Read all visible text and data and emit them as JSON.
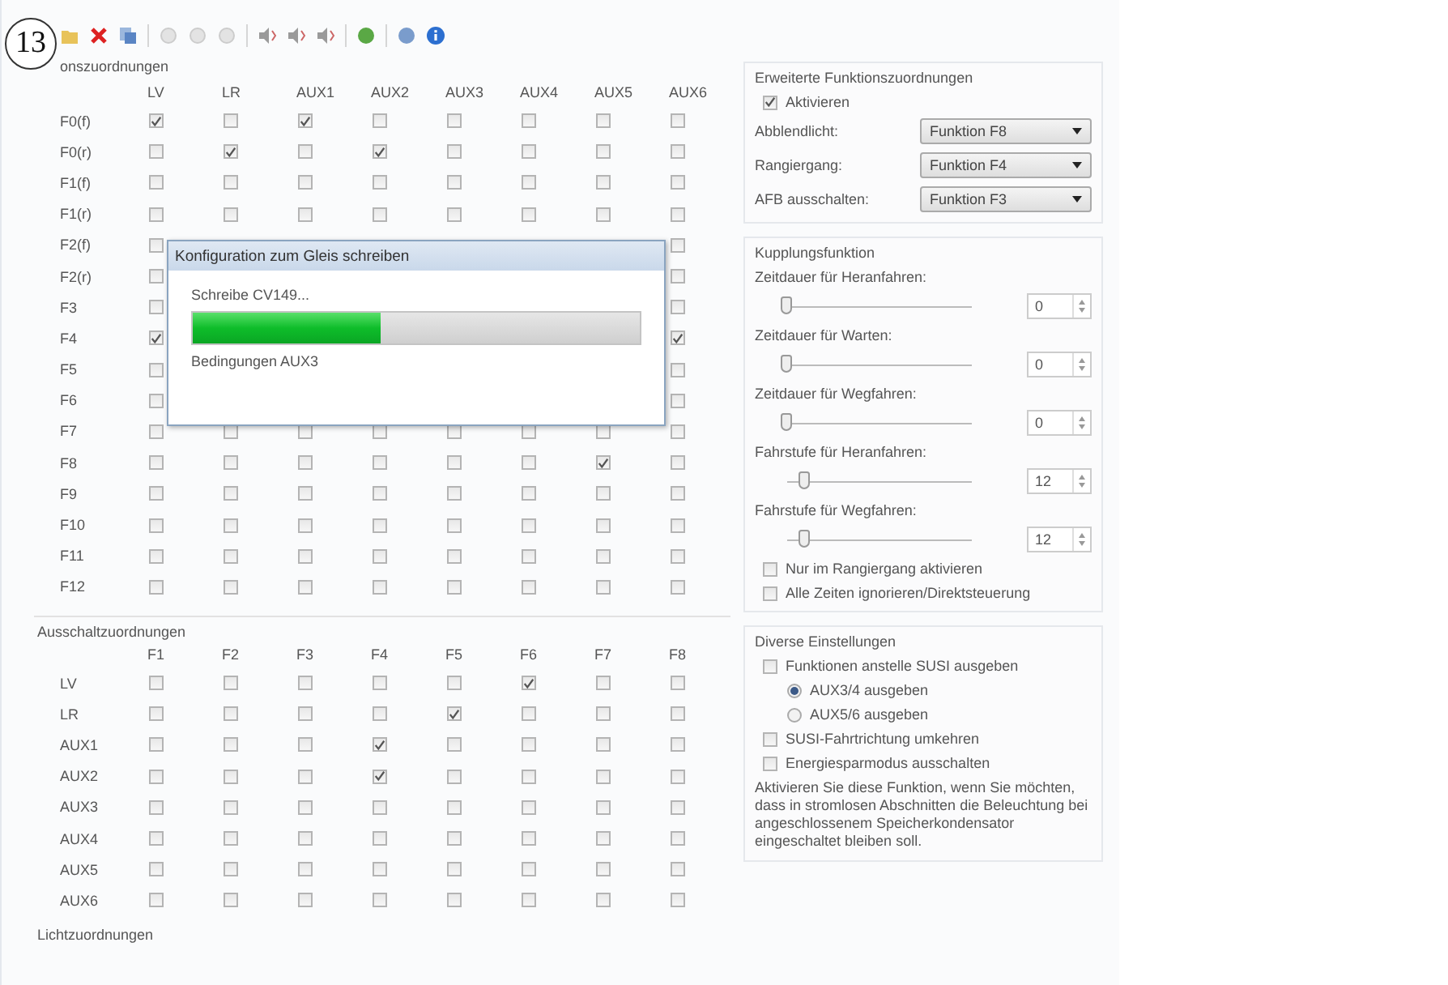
{
  "annotation": "13",
  "toolbar": [
    {
      "kind": "folder"
    },
    {
      "kind": "delete"
    },
    {
      "kind": "copy"
    },
    {
      "kind": "sep"
    },
    {
      "kind": "dot"
    },
    {
      "kind": "dot"
    },
    {
      "kind": "dot"
    },
    {
      "kind": "sep"
    },
    {
      "kind": "speaker"
    },
    {
      "kind": "speaker"
    },
    {
      "kind": "speaker"
    },
    {
      "kind": "sep"
    },
    {
      "kind": "globe"
    },
    {
      "kind": "sep"
    },
    {
      "kind": "help"
    },
    {
      "kind": "info"
    }
  ],
  "function_mapping": {
    "title": "onszuordnungen",
    "columns": [
      "LV",
      "LR",
      "AUX1",
      "AUX2",
      "AUX3",
      "AUX4",
      "AUX5",
      "AUX6"
    ],
    "rows": [
      {
        "label": "F0(f)",
        "cells": [
          {
            "checked": true
          },
          {
            "checked": false
          },
          {
            "checked": true
          },
          {
            "checked": false
          },
          {
            "checked": false
          },
          {
            "checked": false
          },
          {
            "checked": false
          },
          {
            "checked": false
          }
        ]
      },
      {
        "label": "F0(r)",
        "cells": [
          {
            "checked": false
          },
          {
            "checked": true
          },
          {
            "checked": false
          },
          {
            "checked": true
          },
          {
            "checked": false
          },
          {
            "checked": false
          },
          {
            "checked": false
          },
          {
            "checked": false
          }
        ]
      },
      {
        "label": "F1(f)",
        "cells": [
          {
            "checked": false
          },
          {
            "checked": false
          },
          {
            "checked": false
          },
          {
            "checked": false
          },
          {
            "checked": false
          },
          {
            "checked": false
          },
          {
            "checked": false
          },
          {
            "checked": false
          }
        ]
      },
      {
        "label": "F1(r)",
        "cells": [
          {
            "checked": false
          },
          {
            "checked": false
          },
          {
            "checked": false
          },
          {
            "checked": false
          },
          {
            "checked": false
          },
          {
            "checked": false
          },
          {
            "checked": false
          },
          {
            "checked": false
          }
        ]
      },
      {
        "label": "F2(f)",
        "cells": [
          {
            "checked": false
          },
          null,
          null,
          null,
          null,
          null,
          null,
          {
            "checked": false
          }
        ]
      },
      {
        "label": "F2(r)",
        "cells": [
          {
            "checked": false
          },
          null,
          null,
          null,
          null,
          null,
          null,
          {
            "checked": false
          }
        ]
      },
      {
        "label": "F3",
        "cells": [
          {
            "checked": false
          },
          null,
          null,
          null,
          null,
          null,
          null,
          {
            "checked": false
          }
        ]
      },
      {
        "label": "F4",
        "cells": [
          {
            "checked": true
          },
          null,
          null,
          null,
          null,
          null,
          null,
          {
            "checked": true
          }
        ]
      },
      {
        "label": "F5",
        "cells": [
          {
            "checked": false
          },
          null,
          null,
          null,
          null,
          null,
          null,
          {
            "checked": false
          }
        ]
      },
      {
        "label": "F6",
        "cells": [
          {
            "checked": false
          },
          null,
          null,
          null,
          null,
          null,
          null,
          {
            "checked": false
          }
        ]
      },
      {
        "label": "F7",
        "cells": [
          {
            "checked": false
          },
          {
            "checked": false
          },
          {
            "checked": false
          },
          {
            "checked": false
          },
          {
            "checked": false
          },
          {
            "checked": false
          },
          {
            "checked": false
          },
          {
            "checked": false
          }
        ]
      },
      {
        "label": "F8",
        "cells": [
          {
            "checked": false
          },
          {
            "checked": false
          },
          {
            "checked": false
          },
          {
            "checked": false
          },
          {
            "checked": false
          },
          {
            "checked": false
          },
          {
            "checked": true
          },
          {
            "checked": false
          }
        ]
      },
      {
        "label": "F9",
        "cells": [
          {
            "checked": false
          },
          {
            "checked": false
          },
          {
            "checked": false
          },
          {
            "checked": false
          },
          {
            "checked": false
          },
          {
            "checked": false
          },
          {
            "checked": false
          },
          {
            "checked": false
          }
        ]
      },
      {
        "label": "F10",
        "cells": [
          {
            "checked": false
          },
          {
            "checked": false
          },
          {
            "checked": false
          },
          {
            "checked": false
          },
          {
            "checked": false
          },
          {
            "checked": false
          },
          {
            "checked": false
          },
          {
            "checked": false
          }
        ]
      },
      {
        "label": "F11",
        "cells": [
          {
            "checked": false
          },
          {
            "checked": false
          },
          {
            "checked": false
          },
          {
            "checked": false
          },
          {
            "checked": false
          },
          {
            "checked": false
          },
          {
            "checked": false
          },
          {
            "checked": false
          }
        ]
      },
      {
        "label": "F12",
        "cells": [
          {
            "checked": false
          },
          {
            "checked": false
          },
          {
            "checked": false
          },
          {
            "checked": false
          },
          {
            "checked": false
          },
          {
            "checked": false
          },
          {
            "checked": false
          },
          {
            "checked": false
          }
        ]
      }
    ]
  },
  "switch_off_mapping": {
    "title": "Ausschaltzuordnungen",
    "columns": [
      "F1",
      "F2",
      "F3",
      "F4",
      "F5",
      "F6",
      "F7",
      "F8"
    ],
    "rows": [
      {
        "label": "LV",
        "cells": [
          {
            "checked": false
          },
          {
            "checked": false
          },
          {
            "checked": false
          },
          {
            "checked": false
          },
          {
            "checked": false
          },
          {
            "checked": true
          },
          {
            "checked": false
          },
          {
            "checked": false
          }
        ]
      },
      {
        "label": "LR",
        "cells": [
          {
            "checked": false
          },
          {
            "checked": false
          },
          {
            "checked": false
          },
          {
            "checked": false
          },
          {
            "checked": true
          },
          {
            "checked": false
          },
          {
            "checked": false
          },
          {
            "checked": false
          }
        ]
      },
      {
        "label": "AUX1",
        "cells": [
          {
            "checked": false
          },
          {
            "checked": false
          },
          {
            "checked": false
          },
          {
            "checked": true
          },
          {
            "checked": false
          },
          {
            "checked": false
          },
          {
            "checked": false
          },
          {
            "checked": false
          }
        ]
      },
      {
        "label": "AUX2",
        "cells": [
          {
            "checked": false
          },
          {
            "checked": false
          },
          {
            "checked": false
          },
          {
            "checked": true
          },
          {
            "checked": false
          },
          {
            "checked": false
          },
          {
            "checked": false
          },
          {
            "checked": false
          }
        ]
      },
      {
        "label": "AUX3",
        "cells": [
          {
            "checked": false
          },
          {
            "checked": false
          },
          {
            "checked": false
          },
          {
            "checked": false
          },
          {
            "checked": false
          },
          {
            "checked": false
          },
          {
            "checked": false
          },
          {
            "checked": false
          }
        ]
      },
      {
        "label": "AUX4",
        "cells": [
          {
            "checked": false
          },
          {
            "checked": false
          },
          {
            "checked": false
          },
          {
            "checked": false
          },
          {
            "checked": false
          },
          {
            "checked": false
          },
          {
            "checked": false
          },
          {
            "checked": false
          }
        ]
      },
      {
        "label": "AUX5",
        "cells": [
          {
            "checked": false
          },
          {
            "checked": false
          },
          {
            "checked": false
          },
          {
            "checked": false
          },
          {
            "checked": false
          },
          {
            "checked": false
          },
          {
            "checked": false
          },
          {
            "checked": false
          }
        ]
      },
      {
        "label": "AUX6",
        "cells": [
          {
            "checked": false
          },
          {
            "checked": false
          },
          {
            "checked": false
          },
          {
            "checked": false
          },
          {
            "checked": false
          },
          {
            "checked": false
          },
          {
            "checked": false
          },
          {
            "checked": false
          }
        ]
      }
    ]
  },
  "next_section_title": "Lichtzuordnungen",
  "dialog": {
    "title": "Konfiguration zum Gleis schreiben",
    "status": "Schreibe CV149...",
    "level": 0.42,
    "detail": "Bedingungen AUX3"
  },
  "extended": {
    "title": "Erweiterte Funktionszuordnungen",
    "activate": {
      "label": "Aktivieren",
      "checked": true
    },
    "selects": [
      {
        "label": "Abblendlicht:",
        "value": "Funktion F8"
      },
      {
        "label": "Rangiergang:",
        "value": "Funktion F4"
      },
      {
        "label": "AFB ausschalten:",
        "value": "Funktion F3"
      }
    ]
  },
  "coupling": {
    "title": "Kupplungsfunktion",
    "sliders": [
      {
        "label": "Zeitdauer für Heranfahren:",
        "level": 0,
        "value": "0"
      },
      {
        "label": "Zeitdauer für Warten:",
        "level": 0,
        "value": "0"
      },
      {
        "label": "Zeitdauer für Wegfahren:",
        "level": 0,
        "value": "0"
      },
      {
        "label": "Fahrstufe für Heranfahren:",
        "level": 0.1,
        "value": "12"
      },
      {
        "label": "Fahrstufe für Wegfahren:",
        "level": 0.1,
        "value": "12"
      }
    ],
    "options": [
      {
        "label": "Nur im Rangiergang aktivieren",
        "checked": false
      },
      {
        "label": "Alle Zeiten ignorieren/Direktsteuerung",
        "checked": false
      }
    ]
  },
  "misc": {
    "title": "Diverse Einstellungen",
    "items": [
      {
        "kind": "checkbox",
        "label": "Funktionen anstelle SUSI ausgeben",
        "checked": false
      },
      {
        "kind": "radio",
        "label": "AUX3/4 ausgeben",
        "selected": true
      },
      {
        "kind": "radio",
        "label": "AUX5/6 ausgeben",
        "selected": false
      },
      {
        "kind": "checkbox",
        "label": "SUSI-Fahrtrichtung umkehren",
        "checked": false
      },
      {
        "kind": "checkbox",
        "label": "Energiesparmodus ausschalten",
        "checked": false
      }
    ],
    "note": "Aktivieren Sie diese Funktion, wenn Sie möchten, dass in stromlosen Abschnitten die Beleuchtung bei angeschlossenem Speicherkondensator eingeschaltet bleiben soll."
  }
}
